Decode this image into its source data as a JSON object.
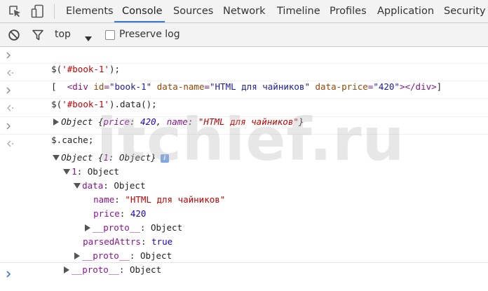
{
  "tabs": [
    {
      "label": "Elements"
    },
    {
      "label": "Console"
    },
    {
      "label": "Sources"
    },
    {
      "label": "Network"
    },
    {
      "label": "Timeline"
    },
    {
      "label": "Profiles"
    },
    {
      "label": "Application"
    },
    {
      "label": "Security"
    }
  ],
  "active_tab": "Console",
  "toolbar": {
    "context": "top",
    "preserve_log_label": "Preserve log",
    "preserve_log_checked": false
  },
  "icons": {
    "inspect": "inspect-element-icon",
    "device": "device-mode-icon",
    "clear": "clear-console-icon",
    "filter": "filter-icon",
    "context_dropdown": "dropdown-arrow-icon",
    "info": "info-icon",
    "input_prompt": "prompt-chevron-icon",
    "result_marker": "result-arrow-icon"
  },
  "console": {
    "cmd1": {
      "prefix": "$(",
      "arg": "'#book-1'",
      "suffix": ");"
    },
    "out1": {
      "open_bracket": "[",
      "tag_open": "<div",
      "attr_id": "id",
      "val_id": "\"book-1\"",
      "attr_name": "data-name",
      "val_name": "\"HTML для чайников\"",
      "attr_price": "data-price",
      "val_price": "\"420\"",
      "tag_close": "></div>",
      "close_bracket": "]"
    },
    "cmd2": {
      "prefix": "$(",
      "arg": "'#book-1'",
      "suffix": ").data();"
    },
    "out2": {
      "head": "Object {",
      "k1": "price",
      "v1": "420",
      "k2": "name",
      "v2": "\"HTML для чайников\"",
      "tail": "}"
    },
    "cmd3": {
      "text": "$.cache;"
    },
    "out3": {
      "head": "Object {",
      "k1": "1",
      "v1": "Object",
      "tail": "}",
      "info": "i",
      "tree": {
        "n1_key": "1",
        "n1_val": "Object",
        "data_key": "data",
        "data_val": "Object",
        "name_key": "name",
        "name_val": "\"HTML для чайников\"",
        "price_key": "price",
        "price_val": "420",
        "proto1_key": "__proto__",
        "proto1_val": "Object",
        "parsed_key": "parsedAttrs",
        "parsed_val": "true",
        "proto2_key": "__proto__",
        "proto2_val": "Object",
        "proto3_key": "__proto__",
        "proto3_val": "Object"
      }
    }
  },
  "watermark": "itchief.ru",
  "colors": {
    "accent": "#3879d9",
    "tag": "#881280",
    "attr": "#994500",
    "attr_value": "#1a1aa6",
    "prop": "#881391",
    "string": "#c80000",
    "number": "#1c00cf"
  }
}
